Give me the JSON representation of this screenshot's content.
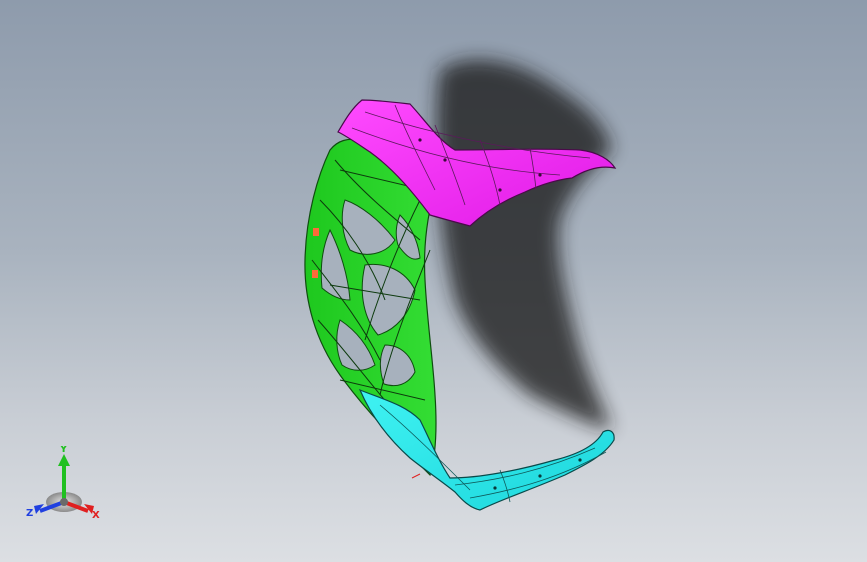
{
  "viewport": {
    "background_top": "#8e9bac",
    "background_bottom": "#dcdfe3"
  },
  "model": {
    "colors": {
      "inner_frame": "#22cc22",
      "outer_skin_top": "#ff22ff",
      "outer_skin_bottom": "#22eeee",
      "edge_lines": "#111111",
      "shadow": "#1e1e1e"
    }
  },
  "triad": {
    "x_label": "X",
    "y_label": "Y",
    "z_label": "Z",
    "x_color": "#e02020",
    "y_color": "#20c020",
    "z_color": "#2040e0"
  }
}
